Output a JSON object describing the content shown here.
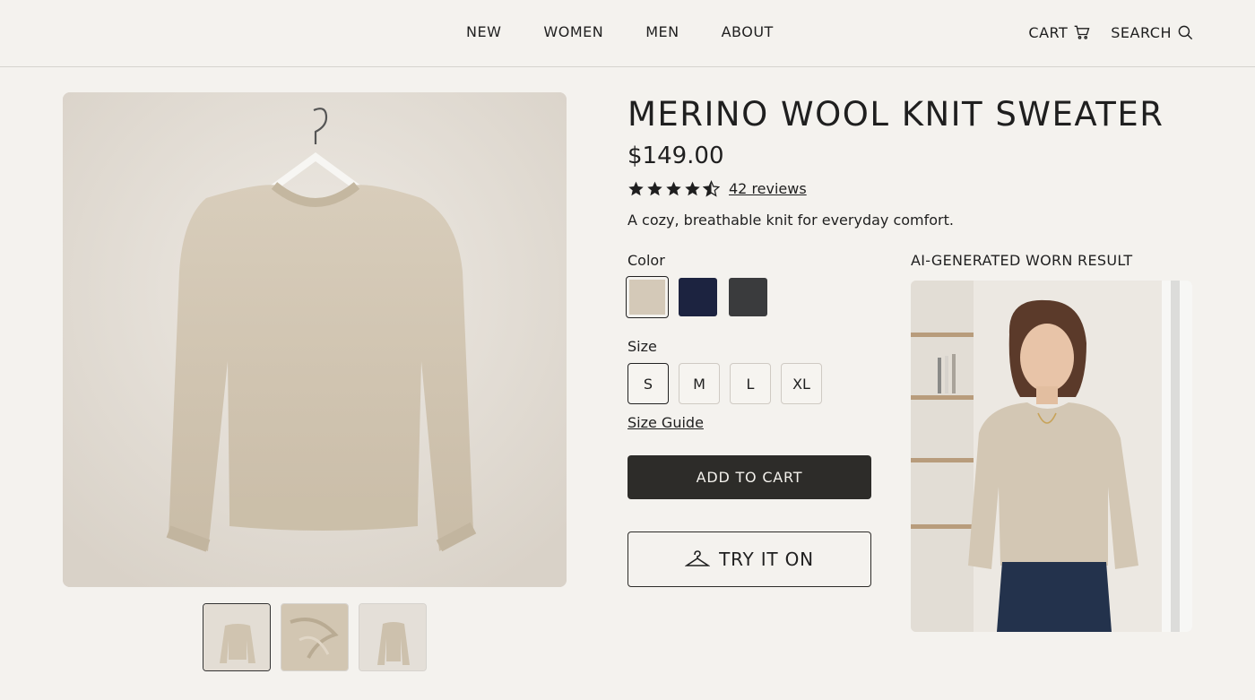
{
  "nav": {
    "items": [
      "NEW",
      "WOMEN",
      "MEN",
      "ABOUT"
    ],
    "cart_label": "CART",
    "search_label": "SEARCH"
  },
  "product": {
    "title": "MERINO WOOL KNIT SWEATER",
    "price": "$149.00",
    "rating": 4.5,
    "reviews_label": "42 reviews",
    "description": "A cozy, breathable knit for everyday comfort.",
    "color_label": "Color",
    "colors": [
      {
        "name": "oatmeal",
        "hex": "#d4c9b8",
        "selected": true
      },
      {
        "name": "navy",
        "hex": "#1c2340",
        "selected": false
      },
      {
        "name": "charcoal",
        "hex": "#3a3b3d",
        "selected": false
      }
    ],
    "size_label": "Size",
    "sizes": [
      "S",
      "M",
      "L",
      "XL"
    ],
    "selected_size": "S",
    "size_guide_label": "Size Guide",
    "add_to_cart_label": "ADD TO CART",
    "try_on_label": "TRY IT ON"
  },
  "worn_result": {
    "label": "AI-GENERATED WORN RESULT"
  },
  "gallery": {
    "thumbnails": [
      "sweater-on-hanger",
      "knit-texture",
      "sweater-side"
    ],
    "active_index": 0
  },
  "colors": {
    "background": "#f4f2ee",
    "primary_button": "#2d2c29",
    "sweater": "#d4c9b8"
  }
}
